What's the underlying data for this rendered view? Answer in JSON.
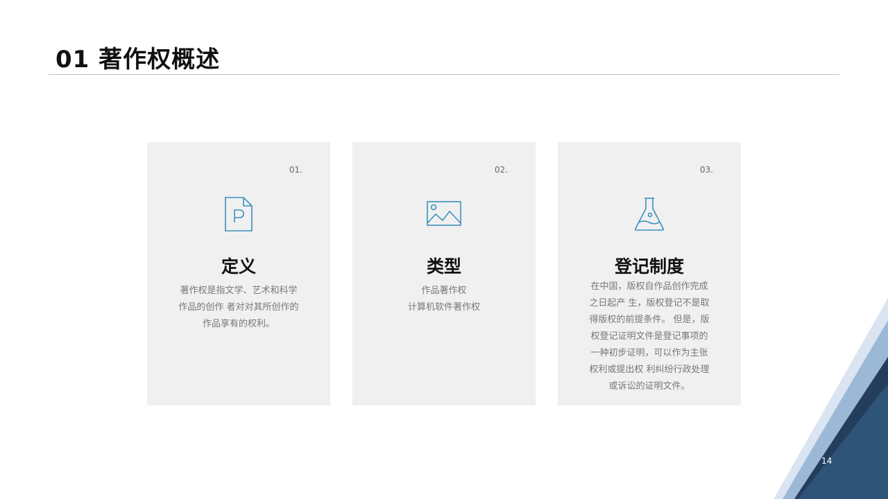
{
  "slide": {
    "title": "01 著作权概述",
    "page_number": "14"
  },
  "cards": [
    {
      "number": "01.",
      "icon": "document-p-icon",
      "heading": "定义",
      "lines": [
        "著作权是指文学、艺术和科学",
        "作品的创作 者对对其所创作的",
        "作品享有的权利。"
      ]
    },
    {
      "number": "02.",
      "icon": "image-icon",
      "heading": "类型",
      "lines": [
        "作品著作权",
        "计算机软件著作权"
      ]
    },
    {
      "number": "03.",
      "icon": "flask-icon",
      "heading": "登记制度",
      "lines": [
        "在中国，版权自作品创作完成",
        "之日起产 生，版权登记不是取",
        "得版权的前提条件。 但是，版",
        "权登记证明文件是登记事项的",
        "一种初步证明，可以作为主张",
        "权利或提出权 利纠纷行政处理",
        "或诉讼的证明文件。"
      ]
    }
  ],
  "colors": {
    "icon": "#3a8fbf",
    "deco_light": "#dbe5f1",
    "deco_mid": "#9bb8d7",
    "deco_dark": "#2e5478",
    "deco_darkest": "#243d5c"
  }
}
